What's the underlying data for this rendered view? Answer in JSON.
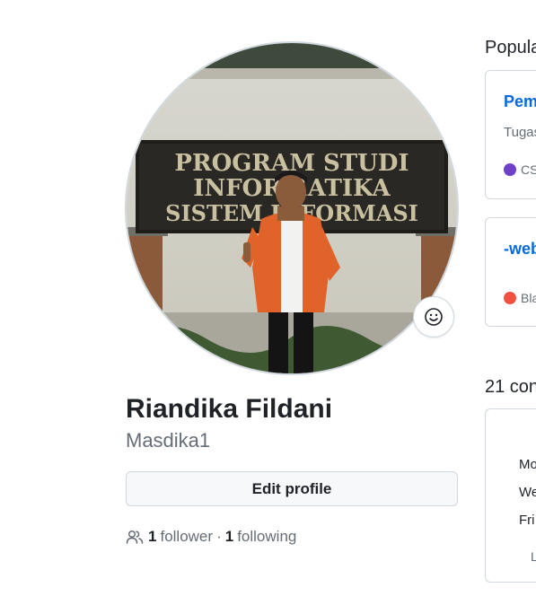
{
  "profile": {
    "full_name": "Riandika Fildani",
    "username": "Masdika1",
    "edit_button": "Edit profile",
    "followers_count": "1",
    "followers_label": "follower",
    "separator": "·",
    "following_count": "1",
    "following_label": "following",
    "avatar_sign_text": [
      "PROGRAM  STUDI",
      "INFORMATIKA",
      "SISTEM INFORMASI"
    ]
  },
  "popular": {
    "title": "Popula",
    "repos": [
      {
        "name": "Pemw",
        "description": "Tugas",
        "language": "CS",
        "language_color": "#6e40c9"
      },
      {
        "name": "-web",
        "description": "",
        "language": "Bla",
        "language_color": "#f1503f"
      }
    ]
  },
  "contributions": {
    "title": "21 con",
    "days": [
      "Mo",
      "We",
      "Fri"
    ],
    "learn_text": "L"
  },
  "colors": {
    "link": "#0969da",
    "muted": "#656d76",
    "border": "#d0d7de",
    "button_bg": "#f6f8fa"
  },
  "icons": {
    "status": "smiley-icon",
    "followers": "people-icon"
  }
}
